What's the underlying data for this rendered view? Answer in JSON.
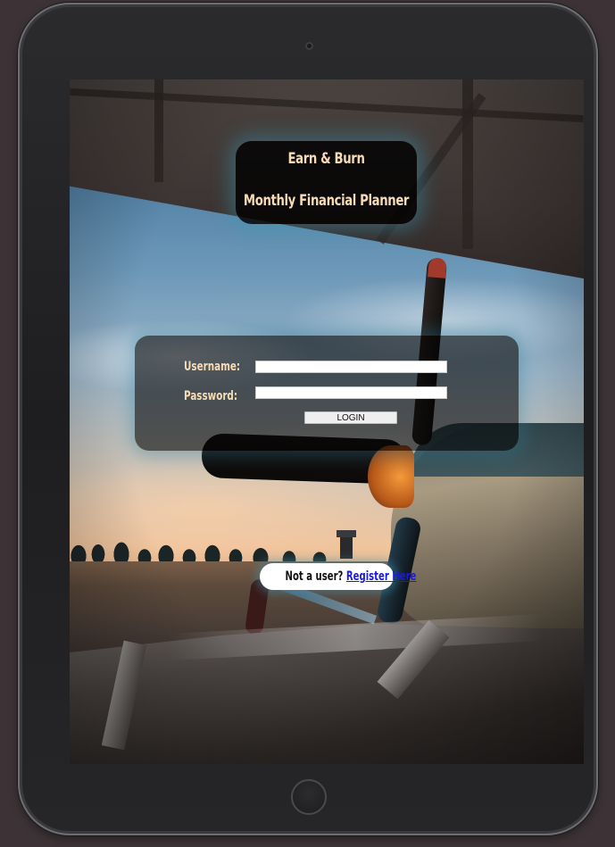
{
  "app": {
    "title_line1": "Earn & Burn",
    "title_line2": "Monthly Financial Planner"
  },
  "login_form": {
    "username_label": "Username:",
    "username_value": "",
    "password_label": "Password:",
    "password_value": "",
    "login_button": "LOGIN"
  },
  "register": {
    "prompt": "Not a user?",
    "link_text": "Register Here"
  },
  "colors": {
    "title_text": "#f6dcb6",
    "panel_glow": "#3896b4",
    "link": "#1a1adf",
    "device_background": "#3d3336"
  },
  "icons": {
    "camera": "camera-icon",
    "home_button": "home-button-icon"
  }
}
